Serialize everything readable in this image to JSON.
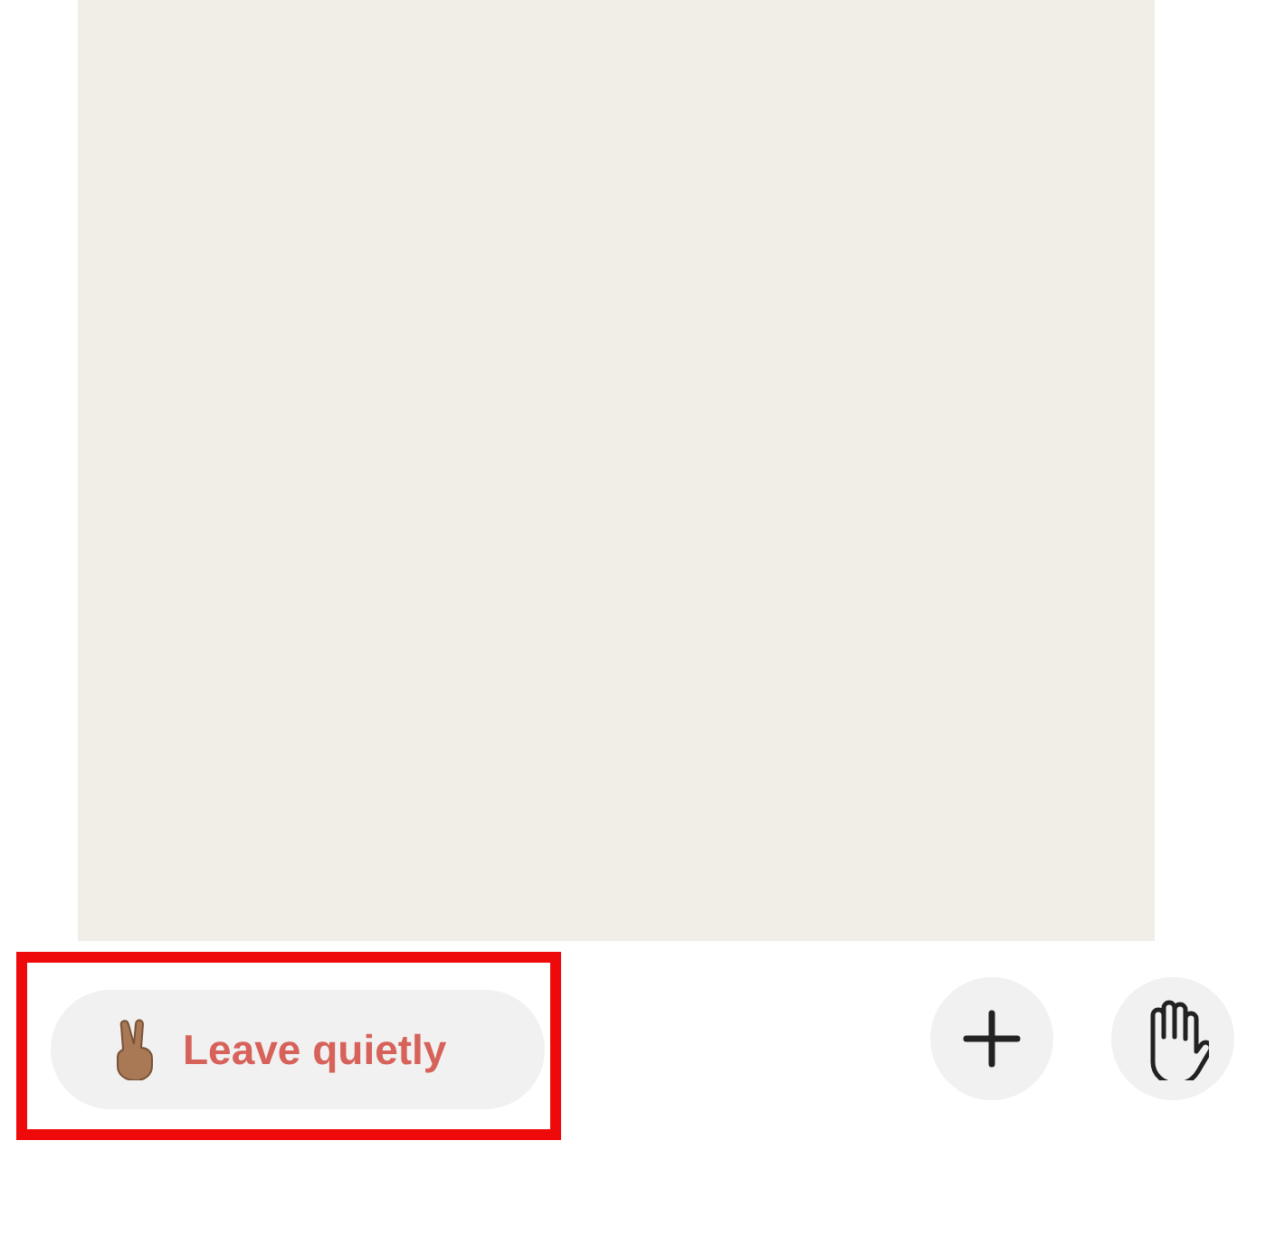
{
  "leave_button": {
    "label": "Leave quietly",
    "highlighted": true
  },
  "actions": [
    {
      "kind": "add"
    },
    {
      "kind": "raise_hand"
    }
  ]
}
